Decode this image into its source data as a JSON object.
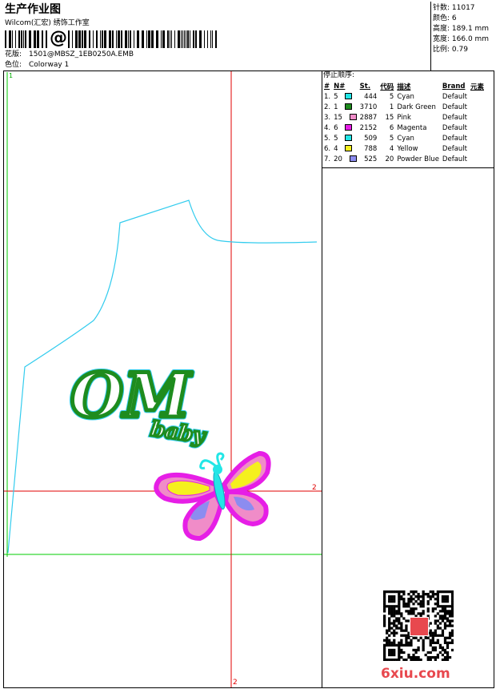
{
  "header": {
    "title": "生产作业图",
    "company": "Wilcom(汇宏) 绣饰工作室",
    "design_label": "花版:",
    "design_value": "1501@MBSZ_1EB0250A.EMB",
    "colorway_label": "色位:",
    "colorway_value": "Colorway 1",
    "barcode_glyph": "@"
  },
  "stats": [
    {
      "label": "针数:",
      "value": "11017"
    },
    {
      "label": "颜色:",
      "value": "6"
    },
    {
      "label": "高度:",
      "value": "189.1 mm"
    },
    {
      "label": "宽度:",
      "value": "166.0 mm"
    },
    {
      "label": "比例:",
      "value": "0.79"
    }
  ],
  "sequence": {
    "title": "停止顺序:",
    "columns": [
      "#",
      "N#",
      "St.",
      "代码",
      "描述",
      "Brand",
      "元素"
    ],
    "rows": [
      {
        "idx": "1.",
        "n": "5",
        "st": "444",
        "code": "5",
        "desc": "Cyan",
        "brand": "Default",
        "color": "#22e6e6"
      },
      {
        "idx": "2.",
        "n": "1",
        "st": "3710",
        "code": "1",
        "desc": "Dark Green",
        "brand": "Default",
        "color": "#1e8c1e"
      },
      {
        "idx": "3.",
        "n": "15",
        "st": "2887",
        "code": "15",
        "desc": "Pink",
        "brand": "Default",
        "color": "#f08cc8"
      },
      {
        "idx": "4.",
        "n": "6",
        "st": "2152",
        "code": "6",
        "desc": "Magenta",
        "brand": "Default",
        "color": "#e61ee6"
      },
      {
        "idx": "5.",
        "n": "5",
        "st": "509",
        "code": "5",
        "desc": "Cyan",
        "brand": "Default",
        "color": "#22e6e6"
      },
      {
        "idx": "6.",
        "n": "4",
        "st": "788",
        "code": "4",
        "desc": "Yellow",
        "brand": "Default",
        "color": "#f5f01e"
      },
      {
        "idx": "7.",
        "n": "20",
        "st": "525",
        "code": "20",
        "desc": "Powder Blue",
        "brand": "Default",
        "color": "#8c8cf0"
      }
    ]
  },
  "canvas": {
    "marker_1": "1",
    "marker_2_right": "2",
    "marker_2_bottom": "2",
    "logo_text": "OM",
    "logo_sub": "baby"
  },
  "watermark": {
    "text": "6xiu.com"
  },
  "colors": {
    "guide_red": "#e00000",
    "guide_green": "#00cc00",
    "outline_cyan": "#33ccee"
  }
}
